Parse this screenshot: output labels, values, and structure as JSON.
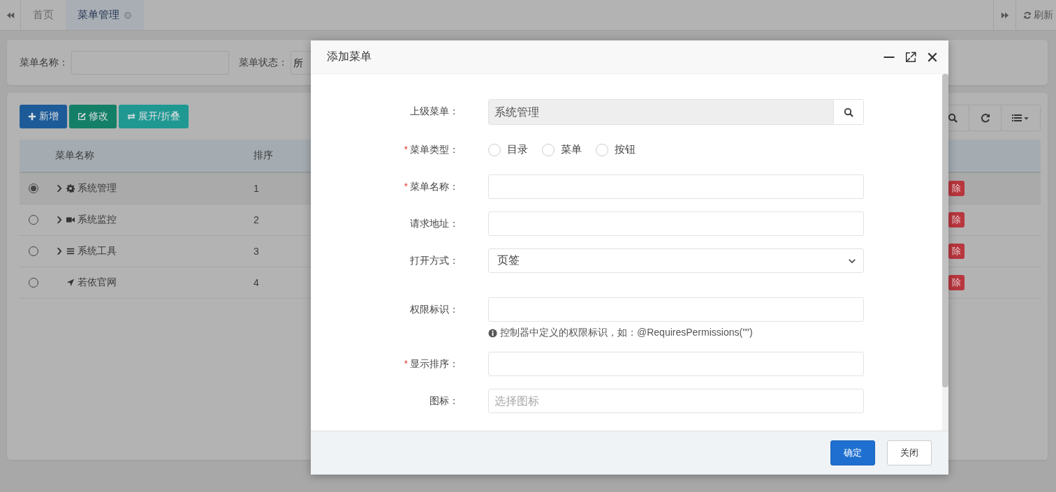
{
  "tab_bar": {
    "tabs": [
      {
        "label": "首页",
        "selected": false
      },
      {
        "label": "菜单管理",
        "selected": true
      }
    ],
    "refresh_label": "刷新"
  },
  "search_form": {
    "fields": [
      {
        "kind": "text",
        "label": "菜单名称："
      },
      {
        "kind": "select",
        "label": "菜单状态：",
        "value": "所"
      }
    ]
  },
  "toolbar": {
    "buttons": [
      {
        "kind": "add",
        "label": "新增"
      },
      {
        "kind": "edit",
        "label": "修改"
      },
      {
        "kind": "toggle",
        "label": "展开/折叠"
      }
    ]
  },
  "table": {
    "columns": [
      "菜单名称",
      "排序"
    ],
    "rows": [
      {
        "selected": true,
        "expandable": true,
        "kind": "gear",
        "name": "系统管理",
        "order": "1",
        "action": "除"
      },
      {
        "selected": false,
        "expandable": true,
        "kind": "video",
        "name": "系统监控",
        "order": "2",
        "action": "除"
      },
      {
        "selected": false,
        "expandable": true,
        "kind": "bars",
        "name": "系统工具",
        "order": "3",
        "action": "除"
      },
      {
        "selected": false,
        "expandable": false,
        "kind": "arrow",
        "name": "若依官网",
        "order": "4",
        "action": "除"
      }
    ]
  },
  "dialog": {
    "title": "添加菜单",
    "fields": [
      {
        "kind": "picker",
        "label": "上级菜单：",
        "value": "系统管理"
      },
      {
        "kind": "radio",
        "marker": "*",
        "label": "菜单类型：",
        "options": [
          {
            "label": "目录",
            "selected": false
          },
          {
            "label": "菜单",
            "selected": false
          },
          {
            "label": "按钮",
            "selected": false
          }
        ]
      },
      {
        "kind": "text",
        "marker": "*",
        "label": "菜单名称："
      },
      {
        "kind": "text",
        "label": "请求地址："
      },
      {
        "kind": "select",
        "label": "打开方式：",
        "value": "页签"
      },
      {
        "kind": "text",
        "label": "权限标识：",
        "help": "控制器中定义的权限标识，如：@RequiresPermissions(\"\")"
      },
      {
        "kind": "text",
        "marker": "*",
        "label": "显示排序："
      },
      {
        "kind": "text",
        "label": "图标：",
        "placeholder": "选择图标"
      }
    ],
    "buttons": [
      {
        "kind": "primary",
        "label": "确定"
      },
      {
        "kind": "default",
        "label": "关闭"
      }
    ]
  }
}
